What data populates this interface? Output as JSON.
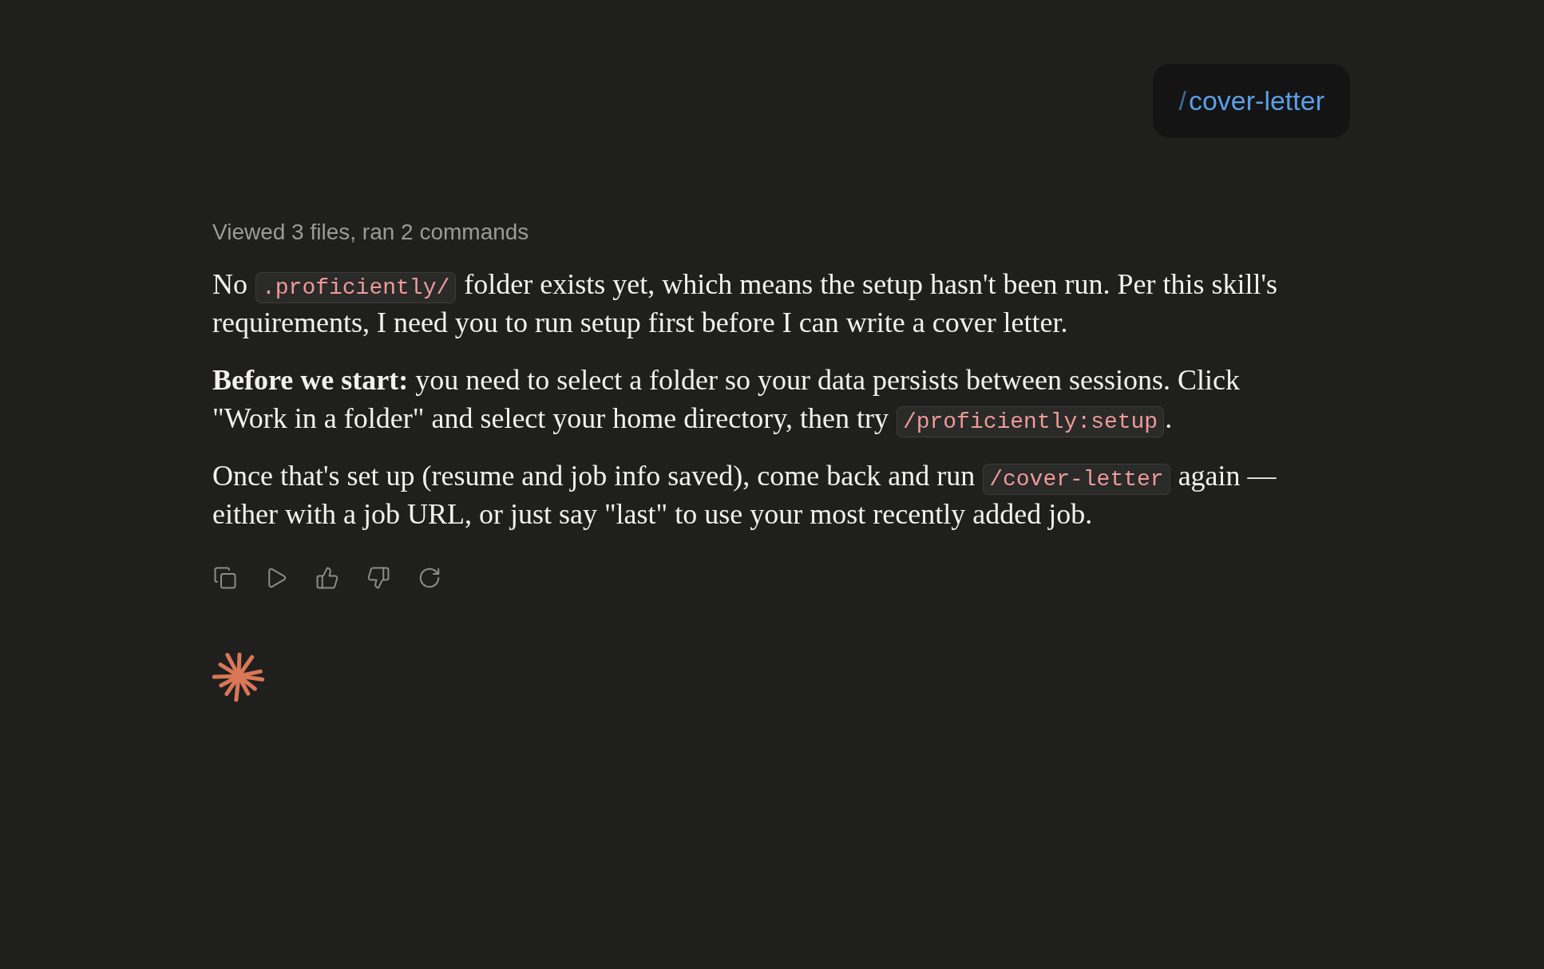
{
  "user_message": {
    "slash": "/",
    "command": "cover-letter"
  },
  "assistant": {
    "activity_summary": "Viewed 3 files, ran 2 commands",
    "paragraphs": [
      {
        "segments": [
          {
            "kind": "text",
            "text": "No "
          },
          {
            "kind": "code",
            "text": ".proficiently/"
          },
          {
            "kind": "text",
            "text": " folder exists yet, which means the setup hasn't been run. Per this skill's requirements, I need you to run setup first before I can write a cover letter."
          }
        ]
      },
      {
        "segments": [
          {
            "kind": "text",
            "text": "**Before we start:** you need to select a folder so your data persists between sessions. Click \"Work in a folder\" and select your home directory, then try "
          },
          {
            "kind": "code",
            "text": "/proficiently:setup"
          },
          {
            "kind": "text",
            "text": "."
          }
        ]
      },
      {
        "segments": [
          {
            "kind": "text",
            "text": "Once that's set up (resume and job info saved), come back and run "
          },
          {
            "kind": "code",
            "text": "/cover-letter"
          },
          {
            "kind": "text",
            "text": " again — either with a job URL, or just say \"last\" to use your most recently added job."
          }
        ]
      }
    ]
  }
}
